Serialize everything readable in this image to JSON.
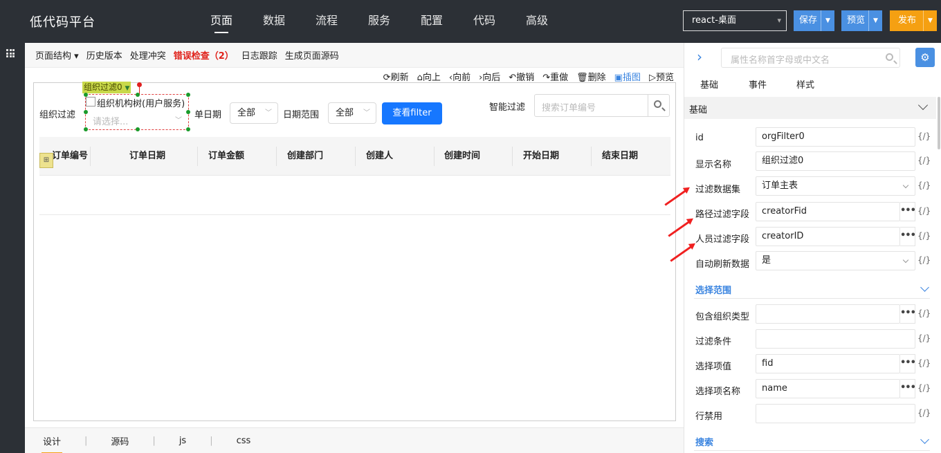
{
  "app": {
    "title": "低代码平台"
  },
  "nav": [
    "页面",
    "数据",
    "流程",
    "服务",
    "配置",
    "代码",
    "高级"
  ],
  "header": {
    "platform": "react-桌面",
    "save": "保存",
    "preview": "预览",
    "publish": "发布",
    "colors": {
      "save": "#4a90e2",
      "preview": "#4a90e2",
      "publish": "#f5a012"
    }
  },
  "toolbar": {
    "items": [
      "页面结构",
      "历史版本",
      "处理冲突",
      "错误检查（2）",
      "日志跟踪",
      "生成页面源码"
    ],
    "actions": [
      "刷新",
      "向上",
      "向前",
      "向后",
      "撤销",
      "重做",
      "删除",
      "插图",
      "预览"
    ]
  },
  "canvas": {
    "org_tag": "组织过滤0",
    "org_filter_label": "组织过滤",
    "org_title": "组织机构树(用户服务)",
    "org_placeholder": "请选择...",
    "order_date_label": "单日期",
    "order_date_value": "全部",
    "date_range_label": "日期范围",
    "date_range_value": "全部",
    "query_button": "查看filter",
    "smart_filter_label": "智能过滤",
    "search_placeholder": "搜索订单编号",
    "columns": [
      "订单编号",
      "订单日期",
      "订单金额",
      "创建部门",
      "创建人",
      "创建时间",
      "开始日期",
      "结束日期"
    ]
  },
  "bottom_tabs": [
    "设计",
    "源码",
    "js",
    "css"
  ],
  "props": {
    "search_placeholder": "属性名称首字母或中文名",
    "tabs": [
      "基础",
      "事件",
      "样式"
    ],
    "section": "基础",
    "expr": "{/}",
    "rows": [
      {
        "label": "id",
        "value": "orgFilter0"
      },
      {
        "label": "显示名称",
        "value": "组织过滤0"
      },
      {
        "label": "过滤数据集",
        "value": "订单主表"
      },
      {
        "label": "路径过滤字段",
        "value": "creatorFid"
      },
      {
        "label": "人员过滤字段",
        "value": "creatorID"
      },
      {
        "label": "自动刷新数据",
        "value": "是"
      }
    ],
    "sub_section": "选择范围",
    "rows2": [
      {
        "label": "包含组织类型",
        "value": ""
      },
      {
        "label": "过滤条件",
        "value": ""
      },
      {
        "label": "选择项值",
        "value": "fid"
      },
      {
        "label": "选择项名称",
        "value": "name"
      },
      {
        "label": "行禁用",
        "value": ""
      }
    ],
    "sub_section2": "搜索"
  }
}
